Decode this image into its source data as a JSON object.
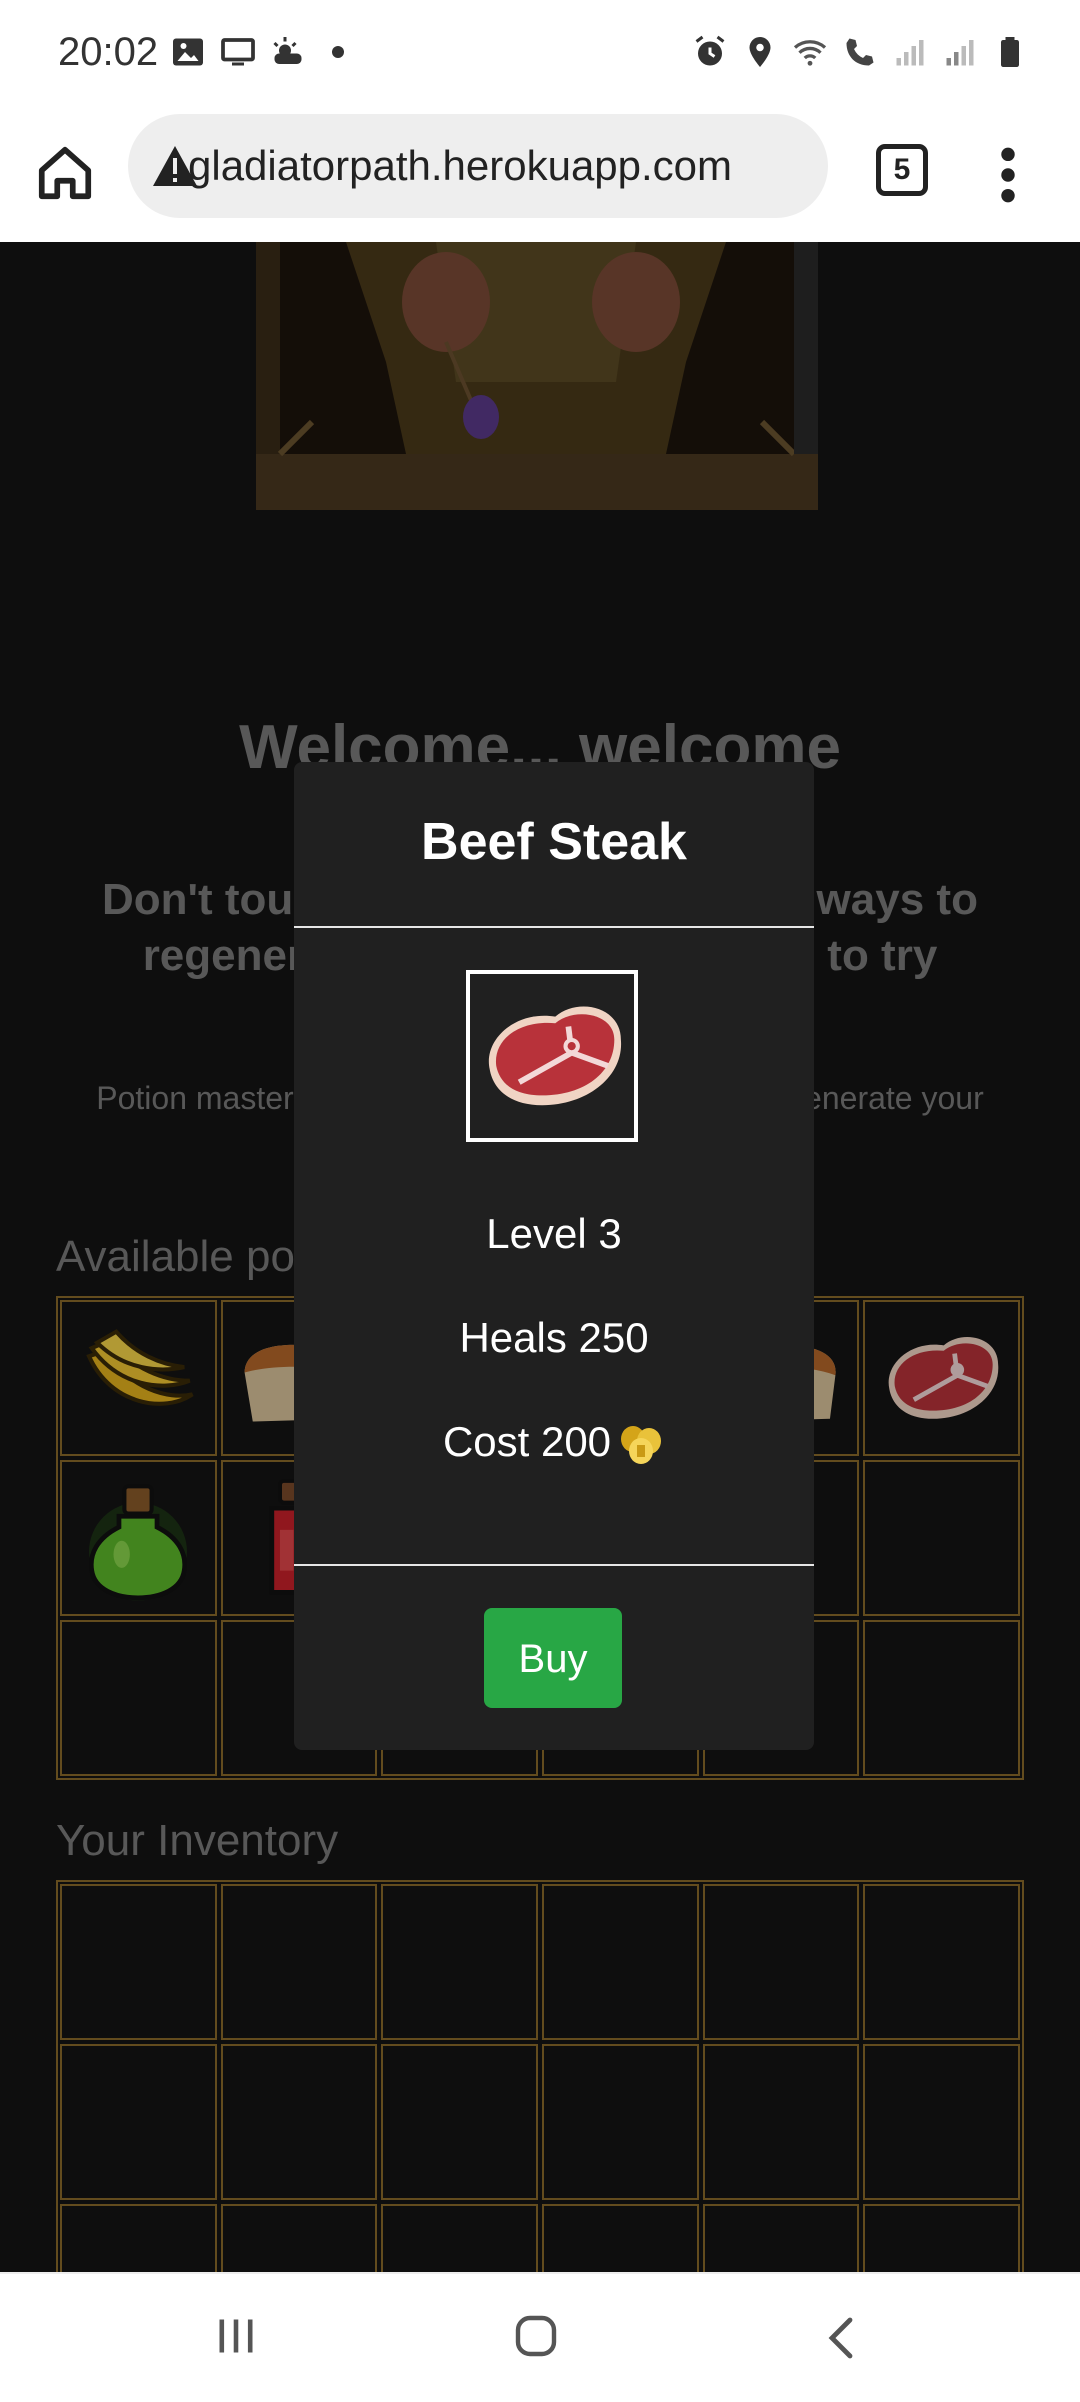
{
  "status_bar": {
    "time": "20:02",
    "left_icons": [
      "image-icon",
      "cast-icon",
      "weather-icon",
      "dot-icon"
    ],
    "right_icons": [
      "alarm-icon",
      "location-icon",
      "wifi-icon",
      "wifi-calling-icon",
      "signal-icon",
      "signal-roaming-icon",
      "battery-icon"
    ]
  },
  "browser": {
    "url": "gladiatorpath.herokuapp.com",
    "tab_count": "5"
  },
  "page": {
    "welcome": "Welcome... welcome",
    "dont_touch_line1": "Don't touch a                              ter ways to",
    "dont_touch_line2": "regenerate                              ugh to try",
    "desc": "Potion master pro                                              regenerate your",
    "available_title": "Available po",
    "inventory_title": "Your Inventory",
    "available_items": [
      "banana-icon",
      "bread-icon",
      "",
      "",
      "bread-icon",
      "steak-icon",
      "green-potion-icon",
      "red-potion-icon",
      "",
      "",
      "",
      "",
      "",
      "",
      "",
      "",
      "",
      ""
    ]
  },
  "modal": {
    "title": "Beef Steak",
    "level": "Level 3",
    "heals": "Heals 250",
    "cost": "Cost 200",
    "coin_icon": "coins-icon",
    "buy_label": "Buy",
    "buy_color": "#28a745"
  },
  "colors": {
    "grid_border": "#8a6a2a",
    "page_bg": "#141414",
    "modal_bg": "#202020"
  }
}
